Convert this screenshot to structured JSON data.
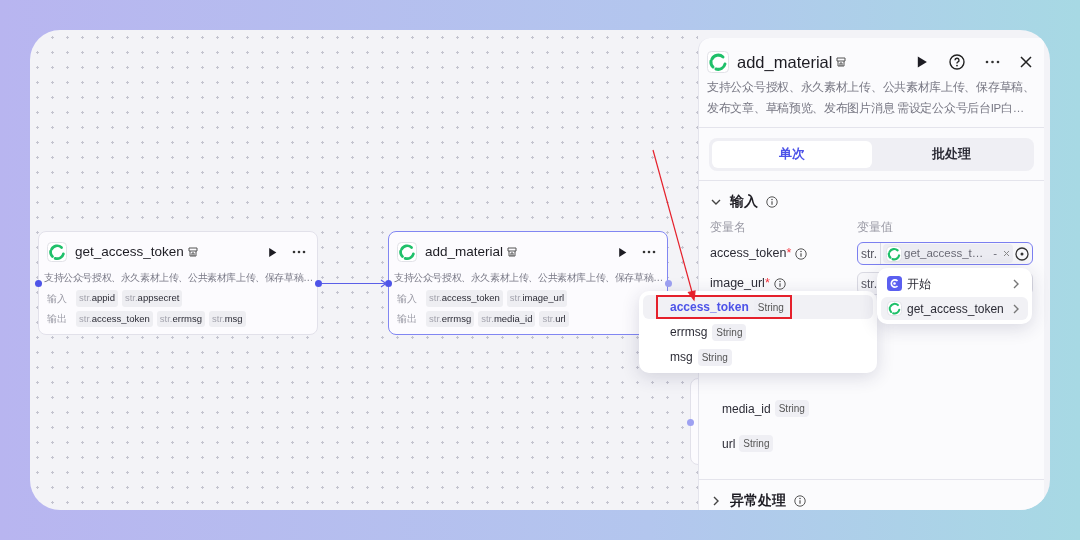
{
  "canvas": {
    "nodes": [
      {
        "title": "get_access_token",
        "description": "支持公众号授权、永久素材上传、公共素材库上传、保存草稿…",
        "selected": false,
        "input_label": "输入",
        "output_label": "输出",
        "inputs": [
          {
            "prefix": "str.",
            "name": "appid"
          },
          {
            "prefix": "str.",
            "name": "appsecret"
          }
        ],
        "outputs": [
          {
            "prefix": "str.",
            "name": "access_token"
          },
          {
            "prefix": "str.",
            "name": "errmsg"
          },
          {
            "prefix": "str.",
            "name": "msg"
          }
        ]
      },
      {
        "title": "add_material",
        "description": "支持公众号授权、永久素材上传、公共素材库上传、保存草稿…",
        "selected": true,
        "input_label": "输入",
        "output_label": "输出",
        "inputs": [
          {
            "prefix": "str.",
            "name": "access_token"
          },
          {
            "prefix": "str.",
            "name": "image_url"
          }
        ],
        "outputs": [
          {
            "prefix": "str.",
            "name": "errmsg"
          },
          {
            "prefix": "str.",
            "name": "media_id"
          },
          {
            "prefix": "str.",
            "name": "url"
          }
        ]
      }
    ]
  },
  "panel": {
    "title": "add_material",
    "description": "支持公众号授权、永久素材上传、公共素材库上传、保存草稿、发布文章、草稿预览、发布图片消息 需设定公众号后台IP白…",
    "tabs": [
      {
        "label": "单次",
        "selected": true
      },
      {
        "label": "批处理",
        "selected": false
      }
    ],
    "input_section": {
      "title": "输入",
      "expanded": true,
      "name_header": "变量名",
      "value_header": "变量值",
      "params": [
        {
          "name": "access_token",
          "required_mark": "*",
          "type_prefix": "str.",
          "value": "get_access_t…",
          "value_suffix": "-"
        },
        {
          "name": "image_url",
          "required_mark": "*",
          "type_prefix": "str."
        }
      ]
    },
    "outputs": [
      {
        "name": "media_id",
        "type": "String"
      },
      {
        "name": "url",
        "type": "String"
      }
    ],
    "error_section": {
      "title": "异常处理",
      "expanded": false
    }
  },
  "source_menu": {
    "items": [
      {
        "kind": "start",
        "label": "开始",
        "selected": false
      },
      {
        "kind": "plugin",
        "label": "get_access_token",
        "selected": true
      }
    ]
  },
  "variable_menu": {
    "items": [
      {
        "name": "access_token",
        "type": "String",
        "selected": true
      },
      {
        "name": "errmsg",
        "type": "String",
        "selected": false
      },
      {
        "name": "msg",
        "type": "String",
        "selected": false
      }
    ]
  }
}
